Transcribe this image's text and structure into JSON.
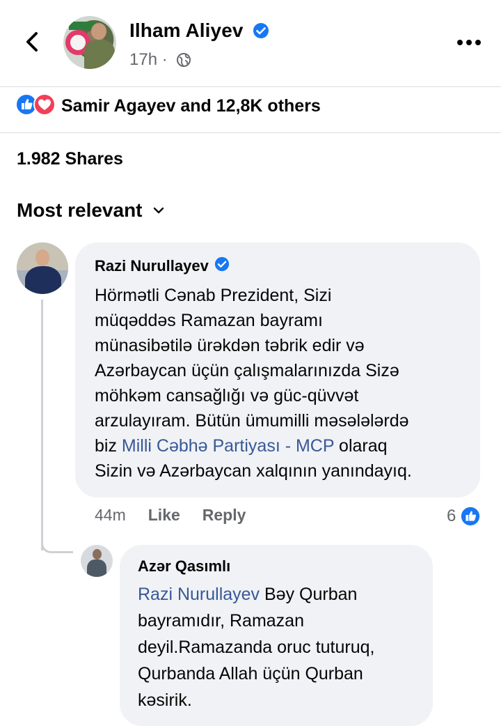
{
  "post": {
    "author": "Ilham Aliyev",
    "time": "17h",
    "separator": "·"
  },
  "reactions": {
    "label": "Samir Agayev and 12,8K others"
  },
  "shares": {
    "label": "1.982 Shares"
  },
  "comments_sort": {
    "label": "Most relevant"
  },
  "comments": [
    {
      "author": "Razi Nurullayev",
      "lines": [
        {
          "text": "Hörmətli Cənab Prezident, Sizi"
        },
        {
          "text": "müqəddəs Ramazan bayramı"
        },
        {
          "text": "münasibətilə ürəkdən təbrik edir və"
        },
        {
          "text": "Azərbaycan üçün çalışmalarınızda Sizə"
        },
        {
          "text": "möhkəm cansağlığı və güc-qüvvət"
        },
        {
          "text": "arzulayıram. Bütün ümumilli məsələlərdə"
        },
        {
          "pre": "biz ",
          "link": "Milli Cəbhə Partiyası - MCP",
          "post": " olaraq"
        },
        {
          "text": "Sizin və Azərbaycan xalqının yanındayıq."
        }
      ],
      "time": "44m",
      "like_label": "Like",
      "reply_label": "Reply",
      "like_count": "6"
    }
  ],
  "replies": [
    {
      "author": "Azər Qasımlı",
      "lines": [
        {
          "link": "Razi Nurullayev",
          "post": " Bəy Qurban"
        },
        {
          "text": "bayramıdır, Ramazan"
        },
        {
          "text": "deyil.Ramazanda oruc tuturuq,"
        },
        {
          "text": "Qurbanda Allah üçün Qurban"
        },
        {
          "text": "kəsirik."
        }
      ]
    }
  ],
  "icons": {
    "back": "chevron-left-icon",
    "verified": "verified-badge-icon",
    "audience": "globe-icon",
    "more": "more-horizontal-icon",
    "like_reaction": "like-reaction-icon",
    "love_reaction": "love-reaction-icon",
    "sort": "chevron-down-icon"
  },
  "colors": {
    "facebook_blue": "#1877f2",
    "love_red": "#f33e58",
    "link": "#385898",
    "muted_text": "#65676b",
    "bubble_bg": "#f0f2f5"
  }
}
